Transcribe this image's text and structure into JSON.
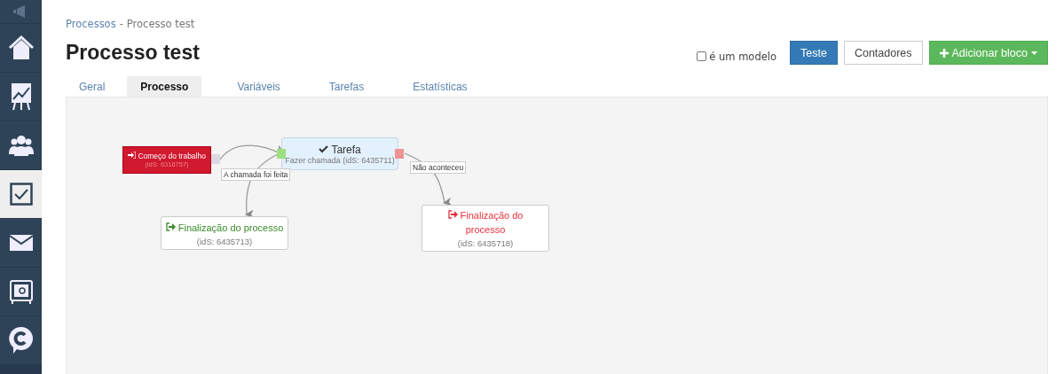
{
  "sidebar": {
    "items": [
      {
        "kind": "announce",
        "selected": false
      },
      {
        "kind": "home",
        "selected": false
      },
      {
        "kind": "chart",
        "selected": false
      },
      {
        "kind": "people",
        "selected": false
      },
      {
        "kind": "tasks",
        "selected": true
      },
      {
        "kind": "mail",
        "selected": false
      },
      {
        "kind": "safe",
        "selected": false
      },
      {
        "kind": "chat",
        "selected": false
      }
    ]
  },
  "breadcrumb": {
    "items": [
      {
        "label": "Processos",
        "kind": "link"
      },
      {
        "label": "Processo test",
        "kind": "current"
      }
    ],
    "separator": "-"
  },
  "title": "Processo test",
  "template_checkbox": {
    "label": "é um modelo",
    "checked": false
  },
  "buttons": [
    {
      "label": "Teste",
      "kind": "primary"
    },
    {
      "label": "Contadores",
      "kind": "default"
    },
    {
      "label": "Adicionar bloco",
      "kind": "success"
    }
  ],
  "tabs": [
    {
      "label": "Geral",
      "selected": false
    },
    {
      "label": "Processo",
      "selected": true
    },
    {
      "label": "Variáveis",
      "selected": false
    },
    {
      "label": "Tarefas",
      "selected": false
    },
    {
      "label": "Estatísticas",
      "selected": false
    }
  ],
  "diagram": {
    "nodes": [
      {
        "kind": "start",
        "title": "Começo do trabalho",
        "subtitle": "(idS: 6316757)"
      },
      {
        "kind": "task",
        "title": "Tarefa",
        "subtitle": "Fazer chamada (idS: 6435711)"
      },
      {
        "kind": "end_success",
        "title": "Finalização do processo",
        "subtitle": "(idS: 6435713)"
      },
      {
        "kind": "end_failure",
        "title": "Finalização do processo",
        "subtitle": "(idS: 6435718)"
      }
    ],
    "edge_labels": [
      "A chamada foi feita",
      "Não aconteceu"
    ]
  }
}
